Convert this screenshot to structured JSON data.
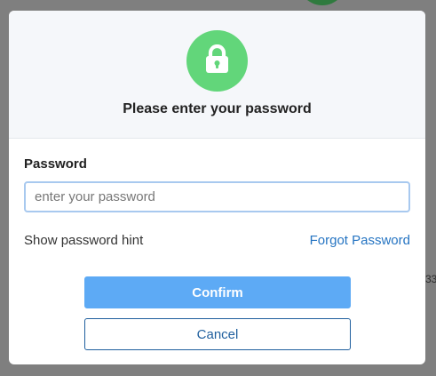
{
  "backdrop": {
    "partial_text": "33"
  },
  "dialog": {
    "icon": "lock-icon",
    "title": "Please enter your password",
    "password_label": "Password",
    "password_placeholder": "enter your password",
    "password_value": "",
    "show_hint_label": "Show password hint",
    "forgot_label": "Forgot Password",
    "confirm_label": "Confirm",
    "cancel_label": "Cancel"
  },
  "colors": {
    "lock_circle": "#62d67a",
    "confirm_button": "#5daaf5",
    "link": "#2574c2",
    "cancel_border": "#1f5f9e"
  }
}
